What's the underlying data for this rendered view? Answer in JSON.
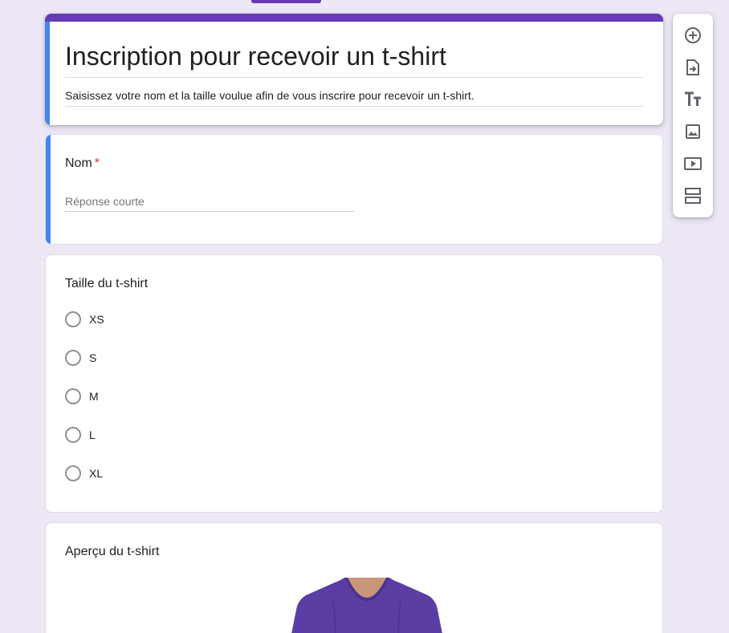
{
  "form": {
    "title": "Inscription pour recevoir un t-shirt",
    "description": "Saisissez votre nom et la taille voulue afin de vous inscrire pour recevoir un t-shirt."
  },
  "questions": {
    "name": {
      "label": "Nom",
      "required_marker": "*",
      "placeholder": "Réponse courte"
    },
    "size": {
      "label": "Taille du t-shirt",
      "options": [
        "XS",
        "S",
        "M",
        "L",
        "XL"
      ]
    },
    "preview": {
      "label": "Aperçu du t-shirt"
    }
  },
  "toolbar": {
    "icons": [
      "add-question-icon",
      "import-questions-icon",
      "add-title-icon",
      "add-image-icon",
      "add-video-icon",
      "add-section-icon"
    ]
  },
  "colors": {
    "theme": "#673ab7",
    "active_accent": "#4285f4",
    "background": "#ede7f6",
    "required": "#d93025",
    "tshirt": "#5b3ea3"
  }
}
